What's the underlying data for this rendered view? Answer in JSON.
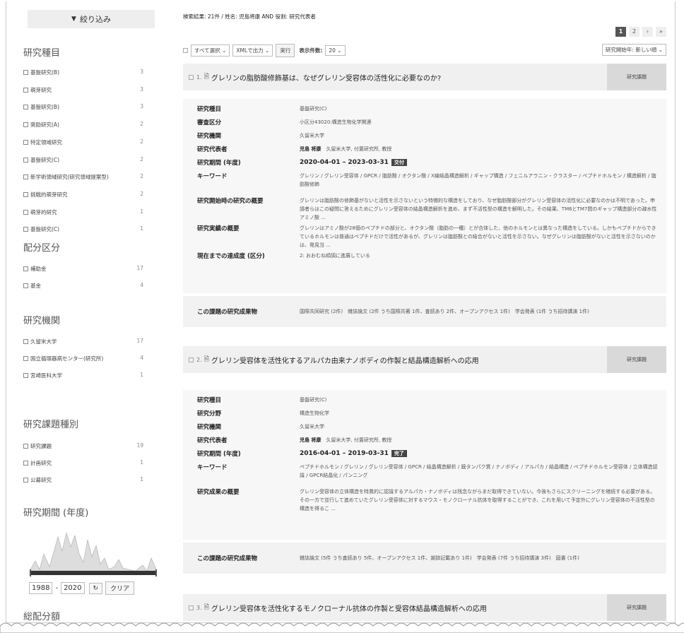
{
  "sidebar": {
    "filter_button": "絞り込み",
    "sections": [
      {
        "title": "研究種目",
        "items": [
          {
            "label": "基盤研究(B)",
            "count": "3"
          },
          {
            "label": "萌芽研究",
            "count": "3"
          },
          {
            "label": "基盤研究(B)",
            "count": "3"
          },
          {
            "label": "奨励研究(A)",
            "count": "2"
          },
          {
            "label": "特定領域研究",
            "count": "2"
          },
          {
            "label": "基盤研究(C)",
            "count": "2"
          },
          {
            "label": "新学術領域研究(研究領域提案型)",
            "count": "2"
          },
          {
            "label": "挑戦的萌芽研究",
            "count": "2"
          },
          {
            "label": "萌芽的研究",
            "count": "1"
          },
          {
            "label": "基盤研究(C)",
            "count": "1"
          }
        ]
      },
      {
        "title": "配分区分",
        "items": [
          {
            "label": "補助金",
            "count": "17"
          },
          {
            "label": "基金",
            "count": "4"
          }
        ]
      },
      {
        "title": "研究機関",
        "items": [
          {
            "label": "久留米大学",
            "count": "17"
          },
          {
            "label": "国立循環器病センター(研究所)",
            "count": "4"
          },
          {
            "label": "宮崎医科大学",
            "count": "1"
          }
        ]
      },
      {
        "title": "研究課題種別",
        "items": [
          {
            "label": "研究課題",
            "count": "19"
          },
          {
            "label": "計画研究",
            "count": "1"
          },
          {
            "label": "公募研究",
            "count": "1"
          }
        ]
      }
    ],
    "period_title": "研究期間 (年度)",
    "range_from": "1988",
    "range_sep": "-",
    "range_to": "2020",
    "clear_label": "クリア",
    "total_title": "総配分額"
  },
  "main": {
    "summary": "検索結果: 21件 / 姓名: 児島将康 AND 役割: 研究代表者",
    "pages": [
      "1",
      "2",
      "›",
      "»"
    ],
    "toolbar": {
      "select_all": "すべて選択",
      "export": "XMLで出力",
      "exec": "実行",
      "per_page_label": "表示件数:",
      "per_page": "20",
      "sort": "研究開始年: 新しい順"
    },
    "tag_label": "研究課題",
    "outcome_label": "この課題の研究成果物",
    "results": [
      {
        "num": "1.",
        "title": "グレリンの脂肪酸修飾基は、なぜグレリン受容体の活性化に必要なのか?",
        "rows": [
          {
            "k": "研究種目",
            "v": "基盤研究(C)"
          },
          {
            "k": "審査区分",
            "v": "小区分43020:構造生物化学関連"
          },
          {
            "k": "研究機関",
            "v": "久留米大学"
          },
          {
            "k": "研究代表者",
            "name": "児島 将康",
            "v": "久留米大学, 付置研究所, 教授"
          },
          {
            "k": "研究期間 (年度)",
            "v": "2020-04-01 – 2023-03-31",
            "badge": "交付"
          },
          {
            "k": "キーワード",
            "v": "グレリン / グレリン受容体 / GPCR / 脂肪酸 / オクタン酸 / X線結晶構造解析 / ギャップ構造 / フェニルアラニン・クラスター / ペプチドホルモン / 構造解析 / 脂肪酸修飾"
          },
          {
            "k": "研究開始時の研究の概要",
            "v": "グレリンは脂肪酸の修飾基がないと活性を示さないという特徴的な構造をしており、なぜ脂肪酸部分がグレリン受容体の活性化に必要なのかは不明であった。申請者らはこの疑問に答えるためにグレリン受容体の結晶構造解析を進め、まず不活性型の構造を解明した。その結果、TM6とTM7間のギャップ構造部分の疎水性アミノ酸 ..."
          },
          {
            "k": "研究実績の概要",
            "v": "グレリンはアミノ酸が28個のペプチドの部分と、オクタン酸（脂肪の一種）とが合体した、他のホルモンとは異なった構造をしている。しかもペプチドからできているホルモンは普通はペプチドだけで活性があるが、グレリンは脂肪酸との結合がないと活性を示さない。なぜグレリンは脂肪酸がないと活性を示さないのかは、発見当 ..."
          },
          {
            "k": "現在までの達成度 (区分)",
            "v": "2: おおむね順調に進展している"
          }
        ],
        "outcome": "国際共同研究 (2件)　雑誌論文 (2件 うち国際共著 1件、査読あり 2件、オープンアクセス 1件)　学会発表 (1件 うち招待講演 1件)"
      },
      {
        "num": "2.",
        "title": "グレリン受容体を活性化するアルパカ由来ナノボディの作製と結晶構造解析への応用",
        "rows": [
          {
            "k": "研究種目",
            "v": "基盤研究(C)"
          },
          {
            "k": "研究分野",
            "v": "構造生物化学"
          },
          {
            "k": "研究機関",
            "v": "久留米大学"
          },
          {
            "k": "研究代表者",
            "name": "児島 将康",
            "v": "久留米大学, 付置研究所, 教授"
          },
          {
            "k": "研究期間 (年度)",
            "v": "2016-04-01 – 2019-03-31",
            "badge": "完了"
          },
          {
            "k": "キーワード",
            "v": "ペプチドホルモン / グレリン / グレリン受容体 / GPCR / 結晶構造解析 / 膜タンパク質 / ナノボディ / アルパカ / 結晶構造 / ペプチドホルモン受容体 / 立体構造認識 / GPCR結晶化 / パンニング"
          },
          {
            "k": "研究成果の概要",
            "v": "グレリン受容体の立体構造を特異的に認識するアルパカ・ナノボディは残念ながらまだ取得できていない。今後もさらにスクリーニングを継続する必要がある。その一方で並行して進めていたグレリン受容体に対するマウス・モノクローナル抗体を取得することができ、これを用いて予定外にグレリン受容体の不活性型の構造を得るこ ..."
          }
        ],
        "outcome": "雑誌論文 (5件 うち査読あり 5件、オープンアクセス 1件、謝辞記載あり 1件)　学会発表 (7件 うち招待講演 3件)　図書 (1件)"
      },
      {
        "num": "3.",
        "title": "グレリン受容体を活性化するモノクローナル抗体の作製と受容体結晶構造解析への応用"
      }
    ]
  }
}
